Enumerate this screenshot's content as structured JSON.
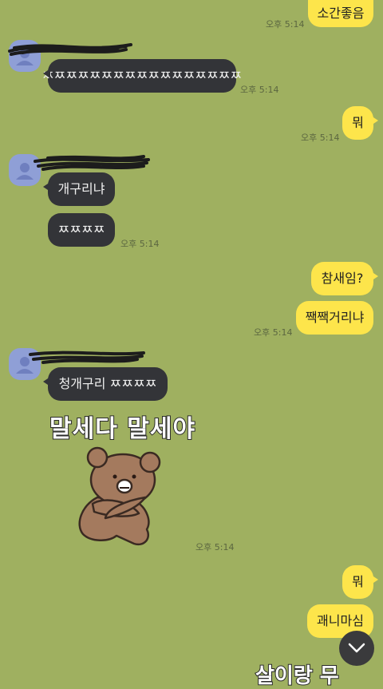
{
  "messages": {
    "m1": {
      "text": "소간좋음",
      "time": "오후 5:14"
    },
    "m2": {
      "text": "ㅉㅉㅉㅉㅉㅉㅉㅉㅉㅉㅉㅉㅉㅉㅉㅉㅉ",
      "time": "오후 5:14"
    },
    "m3": {
      "text": "뭐",
      "time": "오후 5:14"
    },
    "m4": {
      "text": "개구리냐"
    },
    "m5": {
      "text": "ㅉㅉㅉㅉ",
      "time": "오후 5:14"
    },
    "m6": {
      "text": "참새임?"
    },
    "m7": {
      "text": "짹짹거리냐",
      "time": "오후 5:14"
    },
    "m8": {
      "text": "청개구리 ㅉㅉㅉㅉ"
    },
    "sticker": {
      "caption": "말세다 말세야",
      "time": "오후 5:14",
      "icon": "bear-sticker"
    },
    "m9": {
      "text": "뭐"
    },
    "m10": {
      "text": "괘니마심"
    },
    "partial_sticker_text": "살이랑 무"
  },
  "colors": {
    "background": "#9fb060",
    "my_bubble": "#fde54b",
    "their_bubble": "#333438",
    "avatar": "#8f9fd6"
  },
  "icons": {
    "avatar": "default-profile-icon",
    "scroll": "chevron-down-icon"
  }
}
